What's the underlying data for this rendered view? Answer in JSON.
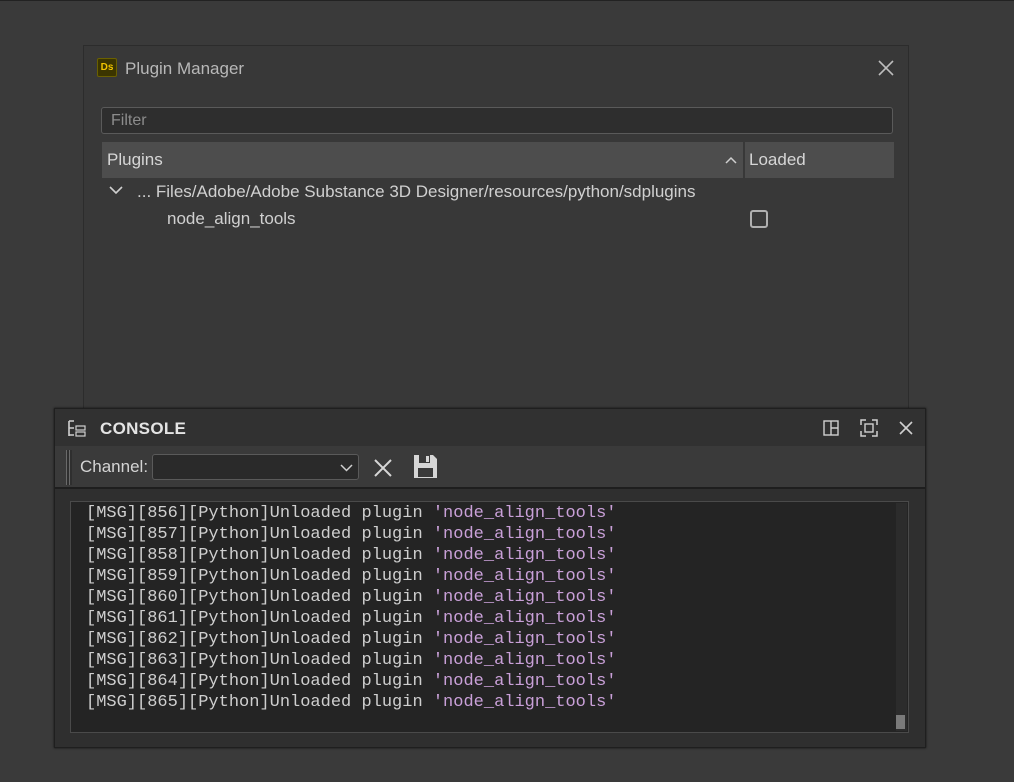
{
  "plugin_manager": {
    "logo_text": "Ds",
    "title": "Plugin Manager",
    "filter_placeholder": "Filter",
    "filter_value": "",
    "columns": {
      "plugins": "Plugins",
      "loaded": "Loaded",
      "sort": "ascending"
    },
    "tree": {
      "folder_path": "... Files/Adobe/Adobe Substance 3D Designer/resources/python/sdplugins",
      "expanded": true,
      "plugins": [
        {
          "name": "node_align_tools",
          "loaded": false
        }
      ]
    }
  },
  "console": {
    "title": "CONSOLE",
    "toolbar": {
      "channel_label": "Channel:",
      "channel_value": ""
    },
    "log": [
      {
        "prefix": "[MSG][856][Python]Unloaded plugin ",
        "quoted": "'node_align_tools'"
      },
      {
        "prefix": "[MSG][857][Python]Unloaded plugin ",
        "quoted": "'node_align_tools'"
      },
      {
        "prefix": "[MSG][858][Python]Unloaded plugin ",
        "quoted": "'node_align_tools'"
      },
      {
        "prefix": "[MSG][859][Python]Unloaded plugin ",
        "quoted": "'node_align_tools'"
      },
      {
        "prefix": "[MSG][860][Python]Unloaded plugin ",
        "quoted": "'node_align_tools'"
      },
      {
        "prefix": "[MSG][861][Python]Unloaded plugin ",
        "quoted": "'node_align_tools'"
      },
      {
        "prefix": "[MSG][862][Python]Unloaded plugin ",
        "quoted": "'node_align_tools'"
      },
      {
        "prefix": "[MSG][863][Python]Unloaded plugin ",
        "quoted": "'node_align_tools'"
      },
      {
        "prefix": "[MSG][864][Python]Unloaded plugin ",
        "quoted": "'node_align_tools'"
      },
      {
        "prefix": "[MSG][865][Python]Unloaded plugin ",
        "quoted": "'node_align_tools'"
      }
    ]
  },
  "colors": {
    "background": "#3a3a3a",
    "dialog": "#383838",
    "header_cell": "#4d4d4d",
    "log_background": "#242424",
    "log_text": "#cfcfcf",
    "log_string": "#c9a0d8",
    "logo_accent": "#f0c400"
  },
  "icons": {
    "logo": "substance-designer-logo",
    "close": "close-icon",
    "sort": "chevron-up-icon",
    "tree_toggle": "chevron-down-icon",
    "console": "tree-hierarchy-icon",
    "split": "split-panel-icon",
    "maximize": "maximize-icon",
    "clear": "clear-icon",
    "save": "save-icon"
  }
}
